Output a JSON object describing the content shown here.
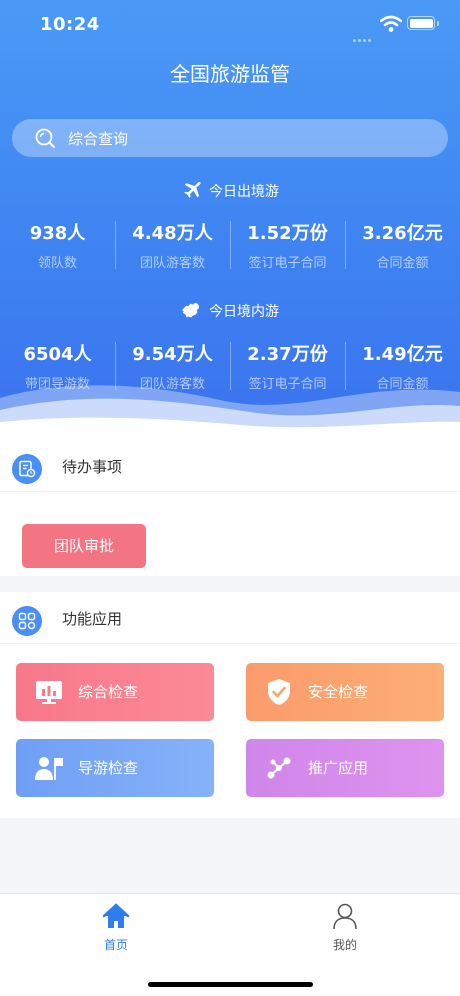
{
  "status_bar": {
    "time": "10:24"
  },
  "header": {
    "title": "全国旅游监管"
  },
  "search": {
    "placeholder": "综合查询"
  },
  "outbound": {
    "title": "今日出境游",
    "stats": [
      {
        "value": "938人",
        "label": "领队数"
      },
      {
        "value": "4.48万人",
        "label": "团队游客数"
      },
      {
        "value": "1.52万份",
        "label": "签订电子合同"
      },
      {
        "value": "3.26亿元",
        "label": "合同金额"
      }
    ]
  },
  "domestic": {
    "title": "今日境内游",
    "stats": [
      {
        "value": "6504人",
        "label": "带团导游数"
      },
      {
        "value": "9.54万人",
        "label": "团队游客数"
      },
      {
        "value": "2.37万份",
        "label": "签订电子合同"
      },
      {
        "value": "1.49亿元",
        "label": "合同金额"
      }
    ]
  },
  "todo": {
    "title": "待办事项",
    "items": [
      "团队审批"
    ]
  },
  "functions": {
    "title": "功能应用",
    "items": [
      {
        "label": "综合检查",
        "icon": "chart-monitor-icon",
        "color": "#f87e8c"
      },
      {
        "label": "安全检查",
        "icon": "shield-check-icon",
        "color": "#fba26f"
      },
      {
        "label": "导游检查",
        "icon": "guide-flag-icon",
        "color": "#7aa8f7"
      },
      {
        "label": "推广应用",
        "icon": "share-nodes-icon",
        "color": "#d38bec"
      }
    ]
  },
  "tabbar": {
    "items": [
      {
        "label": "首页",
        "icon": "home-icon",
        "active": true
      },
      {
        "label": "我的",
        "icon": "user-icon",
        "active": false
      }
    ],
    "active_color": "#2f7cf0",
    "inactive_color": "#555555"
  }
}
